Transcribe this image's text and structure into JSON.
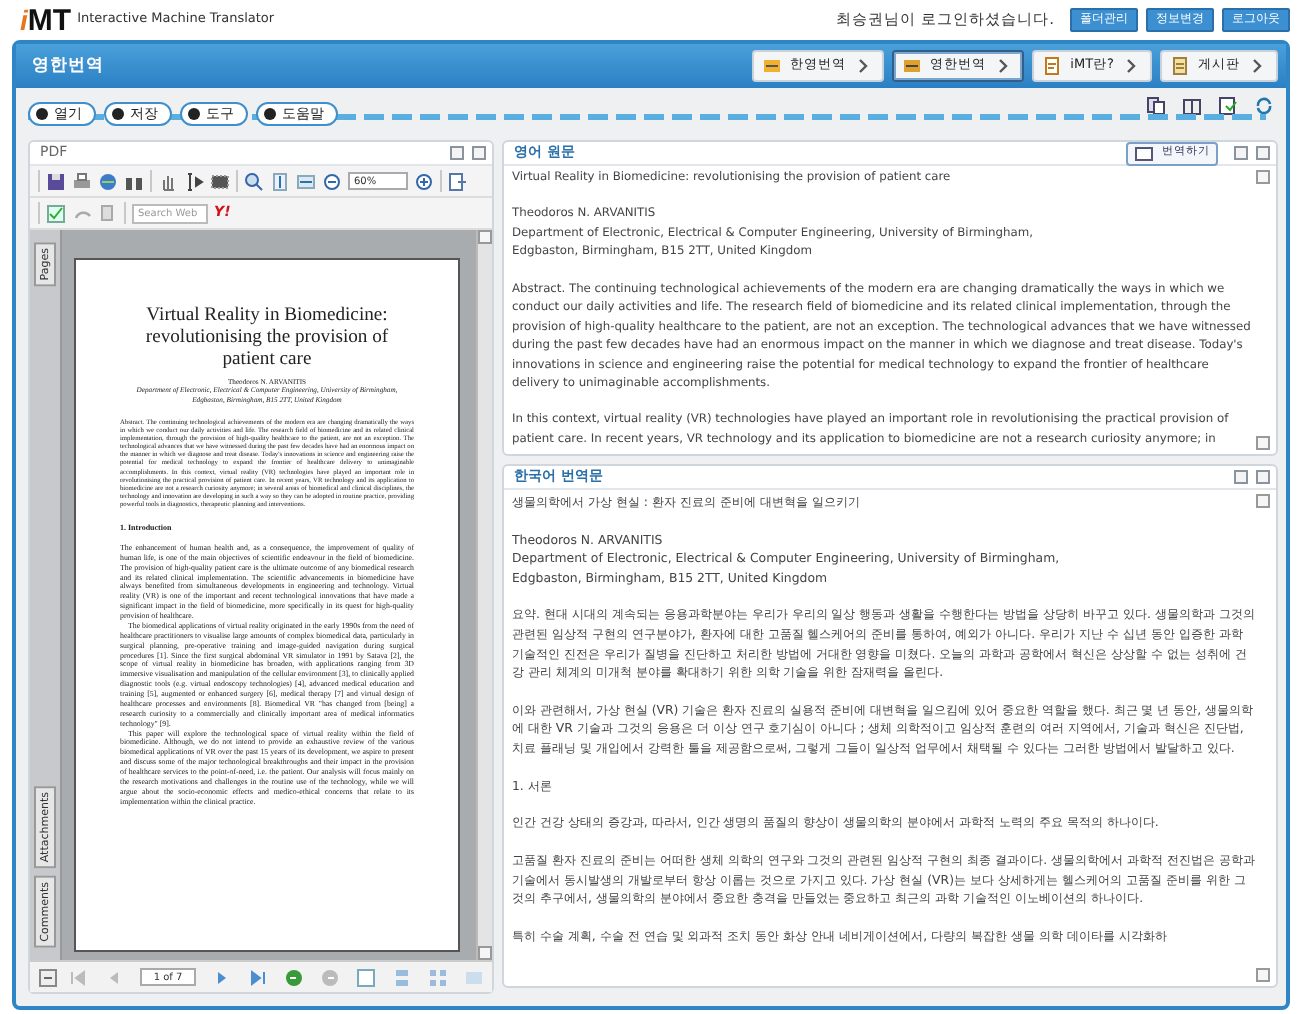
{
  "app": {
    "logo": "MT",
    "logo_prefix": "i",
    "subtitle": "Interactive Machine Translator",
    "login_message": "최승권님이 로그인하셨습니다.",
    "account_buttons": [
      "폴더관리",
      "정보변경",
      "로그아웃"
    ]
  },
  "title_bar": {
    "title": "영한번역",
    "nav": [
      {
        "label": "한영번역",
        "selected": false
      },
      {
        "label": "영한번역",
        "selected": true
      },
      {
        "label": "iMT란?",
        "selected": false
      },
      {
        "label": "게시판",
        "selected": false
      }
    ]
  },
  "menu": [
    "열기",
    "저장",
    "도구",
    "도움말"
  ],
  "pdf_panel": {
    "title": "PDF",
    "zoom": "60%",
    "search_placeholder": "Search Web",
    "search_logo": "Y!",
    "side_tabs": [
      "Pages",
      "Attachments",
      "Comments"
    ],
    "page_indicator": "1 of 7",
    "document": {
      "title": "Virtual Reality in Biomedicine: revolutionising the provision of patient care",
      "author": "Theodoros N. ARVANITIS",
      "affiliation": "Department of Electronic, Electrical & Computer Engineering, University of Birmingham, Edgbaston, Birmingham, B15 2TT, United Kingdom",
      "abstract": "Abstract. The continuing technological achievements of the modern era are changing dramatically the ways in which we conduct our daily activities and life. The research field of biomedicine and its related clinical implementation, through the provision of high-quality healthcare to the patient, are not an exception. The technological advances that we have witnessed during the past few decades have had an enormous impact on the manner in which we diagnose and treat disease. Today's innovations in science and engineering raise the potential for medical technology to expand the frontier of healthcare delivery to unimaginable accomplishments. In this context, virtual reality (VR) technologies have played an important role in revolutionising the practical provision of patient care. In recent years, VR technology and its application to biomedicine are not a research curiosity anymore; in several areas of biomedical and clinical disciplines, the technology and innovation are developing in such a way so they can be adopted in routine practice, providing powerful tools in diagnostics, therapeutic planning and interventions.",
      "heading": "1. Introduction",
      "paragraphs": [
        "The enhancement of human health and, as a consequence, the improvement of quality of human life, is one of the main objectives of scientific endeavour in the field of biomedicine. The provision of high-quality patient care is the ultimate outcome of any biomedical research and its related clinical implementation. The scientific advancements in biomedicine have always benefited from simultaneous developments in engineering and technology. Virtual reality (VR) is one of the important and recent technological innovations that have made a significant impact in the field of biomedicine, more specifically in its quest for high-quality provision of healthcare.",
        "The biomedical applications of virtual reality originated in the early 1990s from the need of healthcare practitioners to visualise large amounts of complex biomedical data, particularly in surgical planning, pre-operative training and image-guided navigation during surgical procedures [1]. Since the first surgical abdominal VR simulator in 1991 by Satava [2], the scope of virtual reality in biomedicine has broaden, with applications ranging from 3D immersive visualisation and manipulation of the cellular environment [3], to clinically applied diagnostic tools (e.g. virtual endoscopy technologies) [4], advanced medical education and training [5], augmented or enhanced surgery [6], medical therapy [7] and virtual design of healthcare processes and environments [8]. Biomedical VR \"has changed from [being] a research curiosity to a commercially and clinically important area of medical informatics technology\" [9].",
        "This paper will explore the technological space of virtual reality within the field of biomedicine. Although, we do not intend to provide an exhaustive review of the various biomedical applications of VR over the past 15 years of its development, we aspire to present and discuss some of the major technological breakthroughs and their impact in the provision of healthcare services to the point-of-need, i.e. the patient. Our analysis will focus mainly on the research motivations and challenges in the routine use of the technology, while we will argue about the socio-economic effects and medico-ethical concerns that relate to its implementation within the clinical practice."
      ]
    }
  },
  "source_panel": {
    "title": "영어 원문",
    "translate_button": "번역하기",
    "blocks": [
      [
        "Virtual Reality in Biomedicine: revolutionising the provision of patient care"
      ],
      [
        "Theodoros N. ARVANITIS",
        "Department of Electronic, Electrical & Computer Engineering, University of Birmingham,",
        "Edgbaston, Birmingham, B15 2TT, United Kingdom"
      ],
      [
        "Abstract. The continuing technological achievements of the modern era are changing dramatically the ways in which we conduct our daily activities and life. The research field of biomedicine and its related clinical implementation, through the provision of high-quality healthcare to the patient, are not an exception. The technological advances that we have witnessed during the past few decades have had an enormous impact on the manner in which we diagnose and treat disease. Today's innovations in science and engineering raise the potential for medical technology to expand the frontier of healthcare delivery to unimaginable accomplishments."
      ],
      [
        "In this context, virtual reality (VR) technologies have played an important role in revolutionising the practical provision of patient care. In recent years, VR technology and its application to biomedicine are not a research curiosity anymore; in"
      ]
    ]
  },
  "target_panel": {
    "title": "한국어 번역문",
    "blocks": [
      [
        "생물의학에서 가상 현실 : 환자 진료의 준비에 대변혁을 일으키기"
      ],
      [
        "Theodoros N. ARVANITIS",
        "Department of Electronic, Electrical & Computer Engineering, University of Birmingham,",
        "Edgbaston, Birmingham, B15 2TT, United Kingdom"
      ],
      [
        "요약. 현대 시대의 계속되는 응용과학분야는 우리가 우리의 일상 행동과 생활을 수행한다는 방법을 상당히 바꾸고 있다. 생물의학과 그것의 관련된 임상적 구현의 연구분야가, 환자에 대한 고품질 헬스케어의 준비를 통하여, 예외가 아니다. 우리가 지난 수 십년 동안 입증한 과학 기술적인 진전은 우리가 질병을 진단하고 처리한 방법에 거대한 영향을 미쳤다. 오늘의 과학과 공학에서 혁신은 상상할 수 없는 성취에 건강 관리 체계의 미개척 분야를 확대하기 위한 의학 기술을 위한 잠재력을 올린다."
      ],
      [
        "이와 관련해서, 가상 현실 (VR) 기술은 환자 진료의 실용적 준비에 대변혁을 일으킴에 있어 중요한 역할을 했다. 최근 몇 년 동안, 생물의학에 대한 VR 기술과 그것의 응용은 더 이상 연구 호기심이 아니다 ; 생체 의학적이고 임상적 훈련의 여러 지역에서, 기술과 혁신은 진단법, 치료 플래닝 및 개입에서 강력한 툴을 제공함으로써, 그렇게 그들이 일상적 업무에서 채택될 수 있다는 그러한 방법에서 발달하고 있다."
      ],
      [
        "1. 서론"
      ],
      [
        "인간 건강 상태의 증강과, 따라서, 인간 생명의 품질의 향상이 생물의학의 분야에서 과학적 노력의 주요 목적의 하나이다."
      ],
      [
        "고품질 환자 진료의 준비는 어떠한 생체 의학의 연구와 그것의 관련된 임상적 구현의 최종 결과이다. 생물의학에서 과학적 전진법은 공학과 기술에서 동시발생의 개발로부터 항상 이롭는 것으로 가지고 있다. 가상 현실 (VR)는 보다 상세하게는 헬스케어의 고품질 준비를 위한 그것의 추구에서, 생물의학의 분야에서 중요한 충격을 만들었는 중요하고 최근의 과학 기술적인 이노베이션의 하나이다."
      ],
      [
        "특히 수술 계획, 수술 전 연습 및 외과적 조치 동안 화상 안내 네비게이션에서, 다량의 복잡한 생물 의학 데이타를 시각화하"
      ]
    ]
  }
}
